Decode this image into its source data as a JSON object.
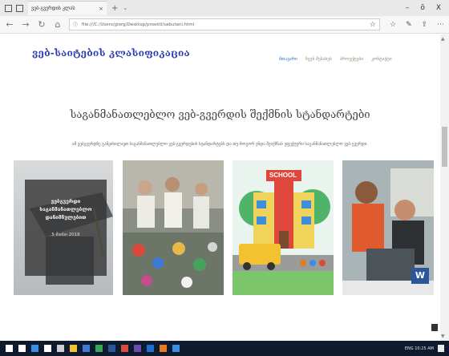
{
  "browser": {
    "tab_title": "ვებ-გვერდის კლას",
    "tab_close": "×",
    "new_tab": "+",
    "tab_dropdown": "⌄",
    "window_controls": [
      "–",
      "ō",
      "X"
    ],
    "nav_buttons": [
      "←",
      "→",
      "↻",
      "⌂"
    ],
    "url_info_icon": "ⓘ",
    "url": "file:///C:/Users/giorg/Desktop/proekti/sabutani.html",
    "toolbar_icons": [
      "☆",
      "✎",
      "⇪",
      "···"
    ],
    "url_star": "☆"
  },
  "site": {
    "brand": "ვებ-საიტების კლასიფიკაცია",
    "nav": [
      {
        "label": "მთავარი",
        "active": true
      },
      {
        "label": "ჩვენ შესახებ",
        "active": false
      },
      {
        "label": "პროექტები",
        "active": false
      },
      {
        "label": "კონტაქტი",
        "active": false
      }
    ],
    "heading": "საგანმანათლებლო ვებ-გვერდის შექმნის სტანდარტები",
    "subtext": "ამ ვებგვერდზე განვიხილავთ საგანმანათლებლო ვებ-გვერდების სტანდარტებს და თუ როგორ უნდა შეიქმნას ეფექტური საგანმანათლებლო ვებ-გვერდი.",
    "cards": [
      {
        "caption": "ვებგვერდი საგანმანათლებლო დანიშნულებით",
        "date": "5 მაისი 2018",
        "image": "graduation-cap-photo"
      },
      {
        "image": "science-fair-photo"
      },
      {
        "image": "school-illustration"
      },
      {
        "image": "students-laptop-photo",
        "badge": "W"
      }
    ]
  },
  "taskbar": {
    "icon_colors": [
      "#ffffff",
      "#ffffff",
      "#3a8ee6",
      "#ffffff",
      "#cfcfcf",
      "#f2c230",
      "#3b7bd6",
      "#36a853",
      "#2b579a",
      "#d94b3a",
      "#6b4bb0",
      "#1f6fd0",
      "#e67a1f",
      "#3a8ee6"
    ],
    "tray_text": "ENG  10:25 AM"
  },
  "colors": {
    "brand": "#2d3cb0",
    "nav_active": "#2f6fc0",
    "taskbar": "#0e1b2e"
  }
}
